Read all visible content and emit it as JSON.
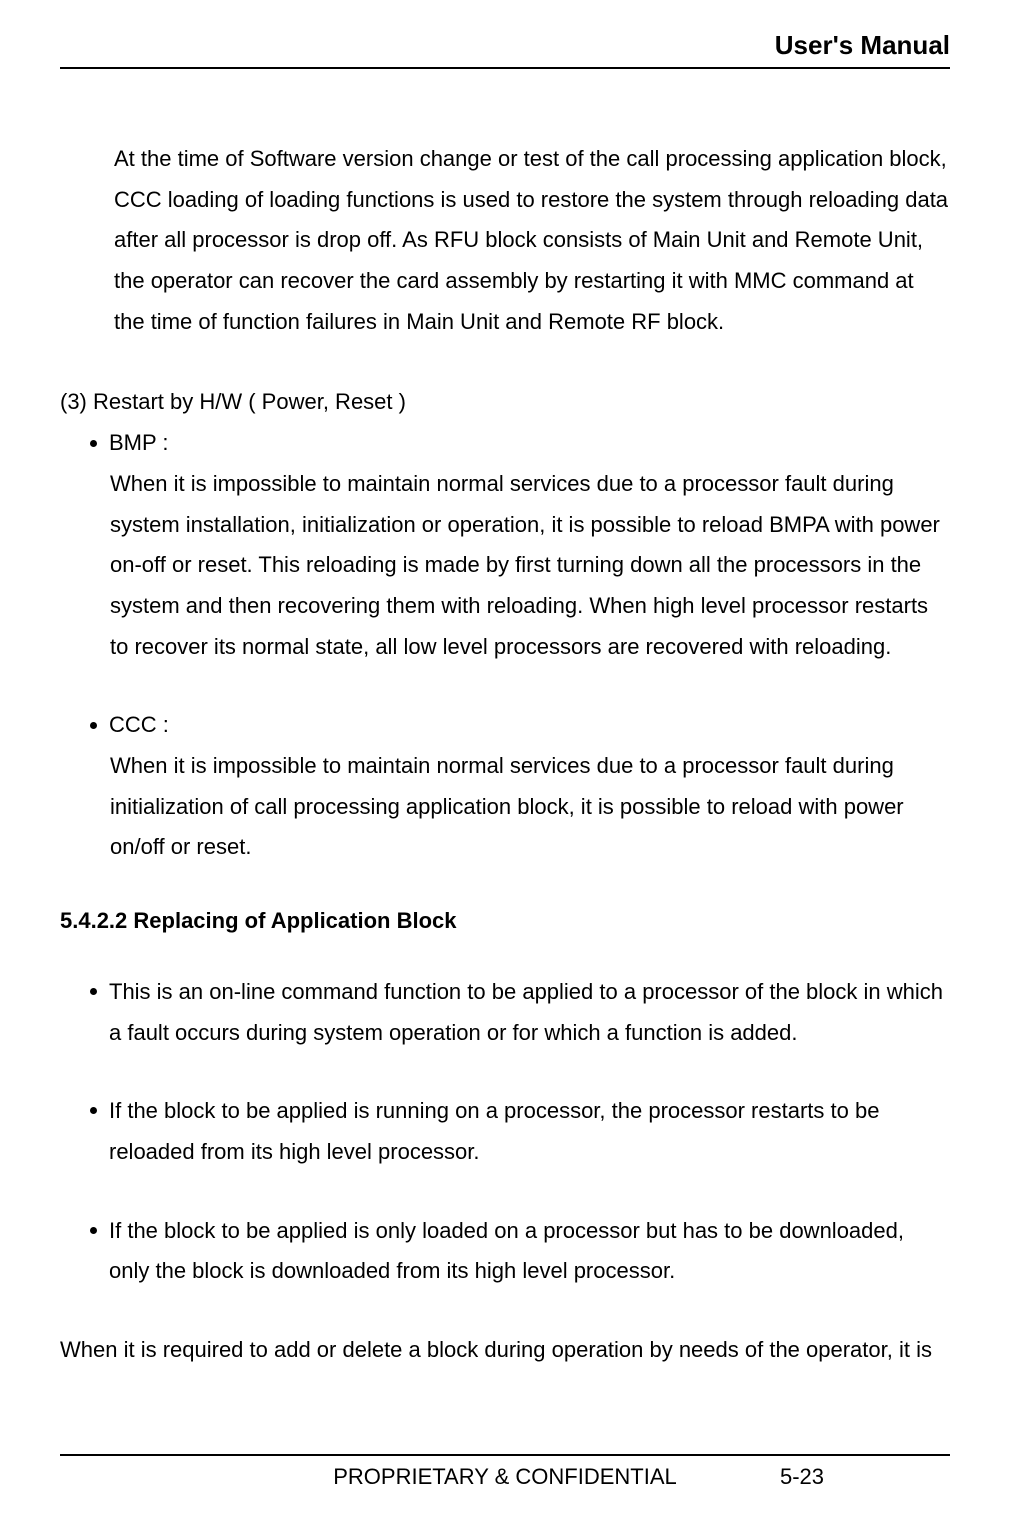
{
  "header": {
    "title": "User's Manual"
  },
  "intro": "At the time of Software version change or test of the call processing application block, CCC loading of loading functions is used to restore the system through reloading data after all processor is drop off. As RFU block consists of Main Unit and Remote Unit, the operator can recover the card assembly by restarting it with MMC command at the time of function failures in Main Unit and Remote RF block.",
  "section3": {
    "title": "(3) Restart by H/W ( Power, Reset )",
    "bullets": [
      {
        "label": "BMP :",
        "body": "When it is impossible to maintain normal services due to a processor fault during system installation, initialization or operation, it is possible to reload BMPA with power on-off or reset. This reloading is made by first turning down all the processors in the system and then recovering them with reloading. When high level processor restarts to recover its normal state, all low level processors are recovered with reloading."
      },
      {
        "label": "CCC :",
        "body": "When it is impossible to maintain normal services due to a processor fault during initialization of call processing application block, it is possible to reload with power on/off or reset."
      }
    ]
  },
  "heading5422": "5.4.2.2 Replacing of Application Block",
  "bullets5422": [
    "This is an on-line command function to be applied to a processor of the block in which a fault occurs during system operation or for which a function is added.",
    "If the block to be applied is running on a processor, the processor restarts to be reloaded from its high level processor.",
    "If the block to be applied is only loaded on a processor but has to be downloaded, only the block is downloaded from its high level processor."
  ],
  "trailing": "When it is required to add or delete a block during operation by needs of the operator, it is",
  "footer": {
    "center": "PROPRIETARY & CONFIDENTIAL",
    "right": "5-23"
  }
}
